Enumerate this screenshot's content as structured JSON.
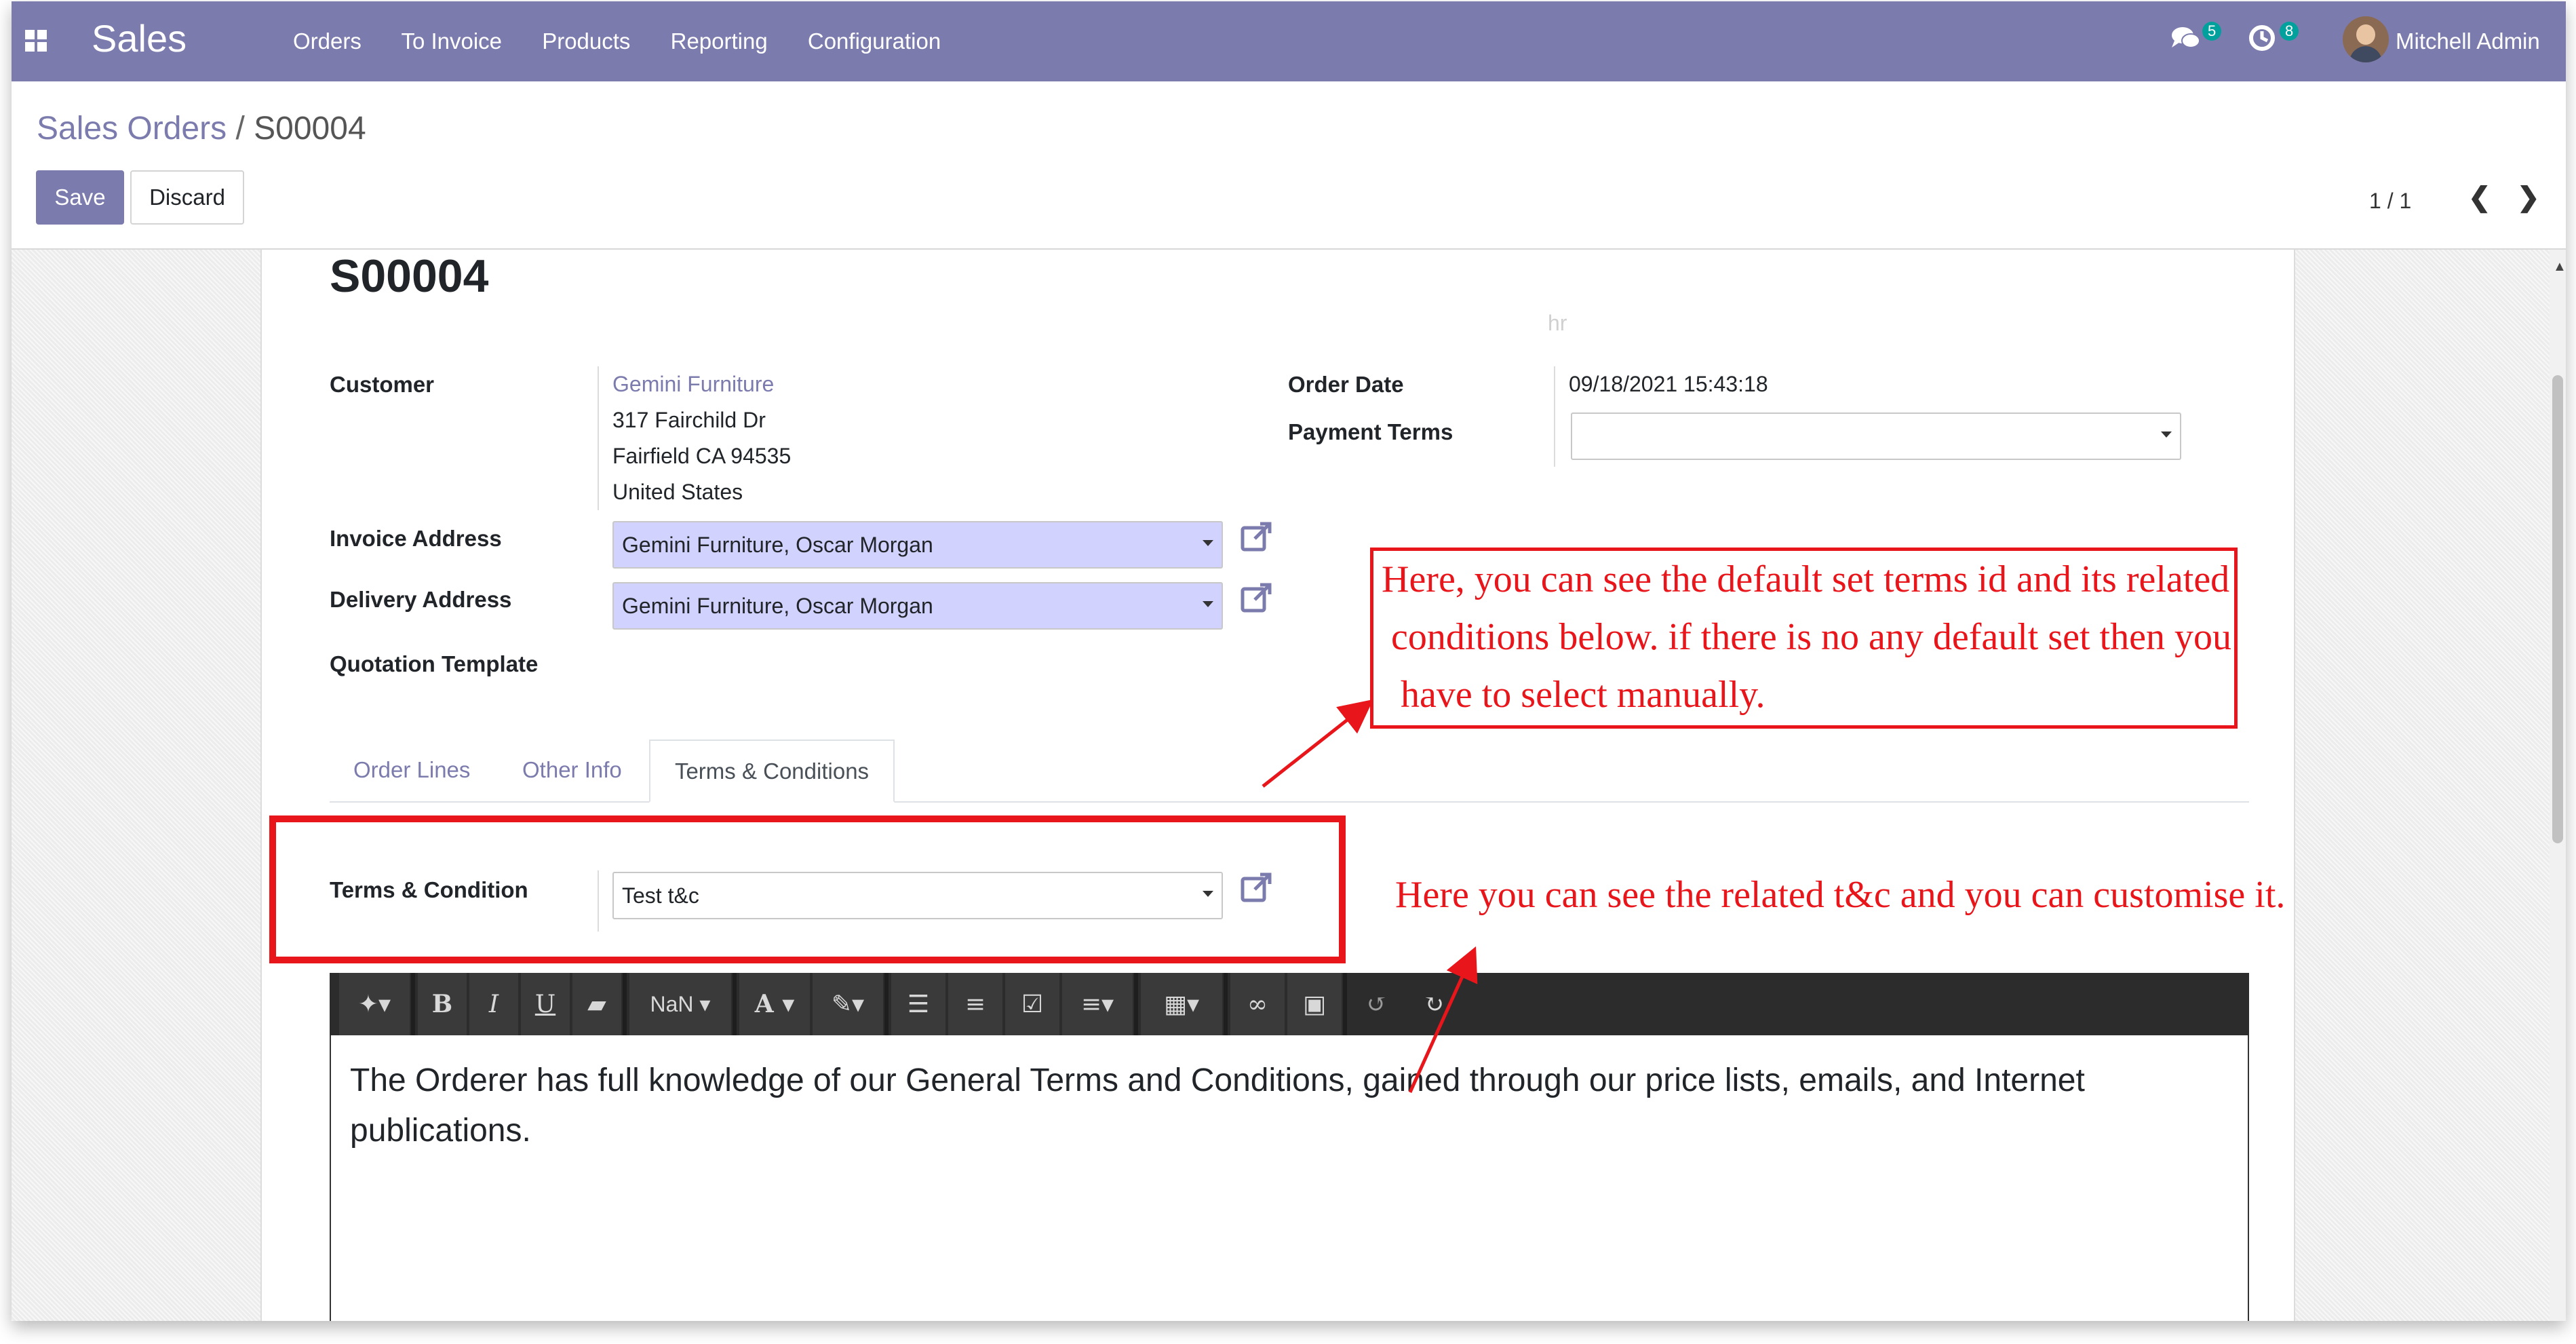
{
  "navbar": {
    "app_name": "Sales",
    "menu": [
      "Orders",
      "To Invoice",
      "Products",
      "Reporting",
      "Configuration"
    ],
    "messages_count": "5",
    "activities_count": "8",
    "user_name": "Mitchell Admin",
    "icons": [
      "apps-grid-icon",
      "chat-icon",
      "clock-icon"
    ]
  },
  "control_panel": {
    "breadcrumb_parent": "Sales Orders",
    "breadcrumb_separator": "/",
    "breadcrumb_current": "S00004",
    "save_label": "Save",
    "discard_label": "Discard",
    "pager": "1 / 1"
  },
  "form": {
    "order_name": "S00004",
    "customer_label": "Customer",
    "customer_name": "Gemini Furniture",
    "customer_address": [
      "317 Fairchild Dr",
      "Fairfield CA 94535",
      "United States"
    ],
    "invoice_address_label": "Invoice Address",
    "invoice_address_value": "Gemini Furniture, Oscar Morgan",
    "delivery_address_label": "Delivery Address",
    "delivery_address_value": "Gemini Furniture, Oscar Morgan",
    "quotation_template_label": "Quotation Template",
    "order_date_label": "Order Date",
    "order_date_value": "09/18/2021 15:43:18",
    "payment_terms_label": "Payment Terms",
    "payment_terms_value": "",
    "faint_mark": "hr"
  },
  "tabs": [
    {
      "label": "Order Lines",
      "active": false
    },
    {
      "label": "Other Info",
      "active": false
    },
    {
      "label": "Terms & Conditions",
      "active": true
    }
  ],
  "terms": {
    "label": "Terms & Condition",
    "value": "Test t&c"
  },
  "editor": {
    "toolbar": {
      "font_size": "NaN",
      "bold": "B",
      "italic": "I",
      "underline": "U",
      "font_color": "A"
    },
    "content": "The Orderer has full knowledge of our General Terms and Conditions, gained through our price lists, emails, and Internet publications."
  },
  "annotations": {
    "note_1_lines": [
      "Here, you can see the default set terms id and its related",
      " conditions below. if there is no any default set then you",
      "  have to select manually."
    ],
    "note_2": "Here you can see the related t&c and you can customise it.",
    "color": "#e8161b"
  },
  "colors": {
    "brand": "#7c7bad",
    "required_field": "#d2d2ff",
    "toolbar_bg": "#2c2c2c"
  }
}
